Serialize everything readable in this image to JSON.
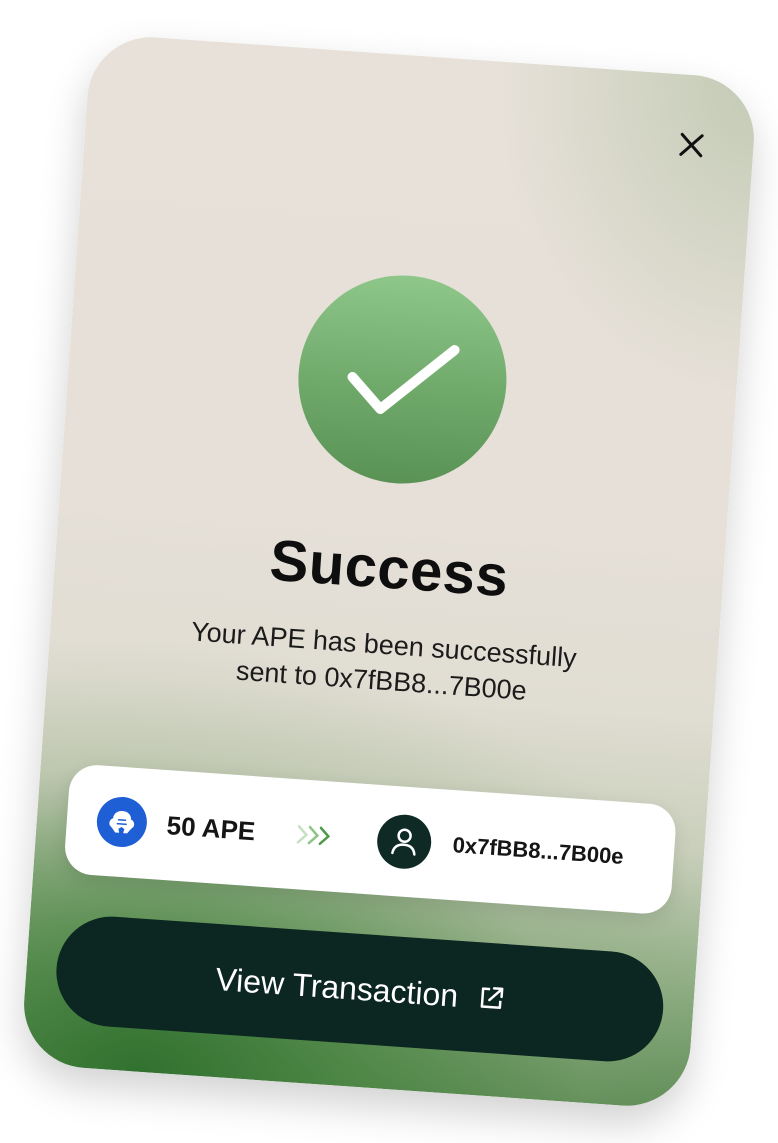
{
  "dialog": {
    "title": "Success",
    "message_line1": "Your APE has been successfully",
    "message_line2": "sent to 0x7fBB8...7B00e"
  },
  "transfer": {
    "amount": "50 APE",
    "token_icon": "ape-token-icon",
    "arrow_icon": "triple-chevron-right-icon",
    "recipient_icon": "user-icon",
    "recipient_address": "0x7fBB8...7B00e"
  },
  "actions": {
    "view_transaction_label": "View Transaction",
    "external_link_icon": "external-link-icon",
    "close_icon": "close-icon"
  },
  "colors": {
    "success_green": "#6fa96a",
    "token_blue": "#1f5fd6",
    "button_dark": "#0c2622"
  }
}
